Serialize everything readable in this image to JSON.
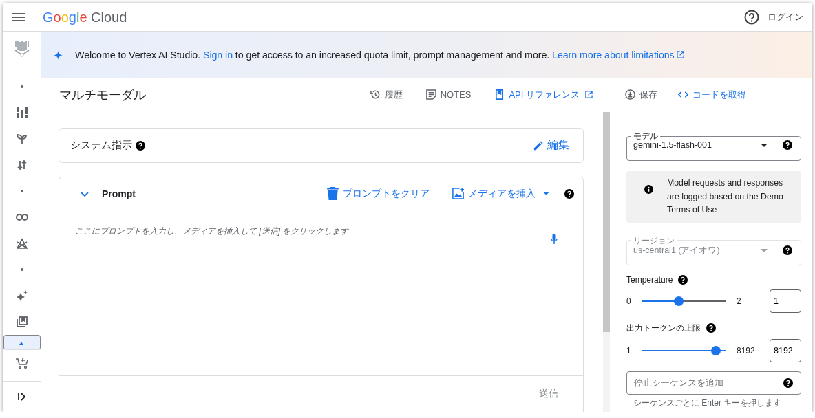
{
  "topbar": {
    "logo_google": "Google",
    "logo_cloud": "Cloud",
    "login": "ログイン"
  },
  "rail": {
    "items": [
      {
        "kind": "dot",
        "selected": false
      },
      {
        "kind": "grid",
        "selected": false
      },
      {
        "kind": "sprout",
        "selected": false
      },
      {
        "kind": "arrows",
        "selected": false
      },
      {
        "kind": "dot",
        "selected": false
      },
      {
        "kind": "link",
        "selected": false
      },
      {
        "kind": "tent",
        "selected": false
      },
      {
        "kind": "dot",
        "selected": false
      },
      {
        "kind": "sparkle",
        "selected": false
      },
      {
        "kind": "library",
        "selected": false
      },
      {
        "kind": "marker",
        "selected": true
      },
      {
        "kind": "cart",
        "selected": false
      }
    ]
  },
  "banner": {
    "lead": "Welcome to Vertex AI Studio.",
    "sign_in": "Sign in",
    "rest": "to get access to an increased quota limit, prompt management and more.",
    "learn_more": "Learn more about limitations"
  },
  "header": {
    "title": "マルチモーダル",
    "actions": [
      {
        "kind": "history",
        "label": "履歴"
      },
      {
        "kind": "notes",
        "label": "NOTES"
      },
      {
        "kind": "api",
        "label": "API リファレンス"
      }
    ],
    "side_actions": [
      {
        "kind": "save",
        "label": "保存"
      },
      {
        "kind": "code",
        "label": "コードを取得"
      }
    ]
  },
  "system": {
    "title": "システム指示",
    "edit": "編集"
  },
  "prompt": {
    "title": "Prompt",
    "expanded": true,
    "clear": "プロンプトをクリア",
    "insert": "メディアを挿入",
    "placeholder": "ここにプロンプトを入力し、メディアを挿入して [送信] をクリックします",
    "send": "送信",
    "send_disabled": true
  },
  "settings": {
    "model": {
      "label": "モデル",
      "value": "gemini-1.5-flash-001",
      "disabled": false
    },
    "notice": "Model requests and responses are logged based on the Demo Terms of Use",
    "region": {
      "label": "リージョン",
      "value": "us-central1 (アイオワ)",
      "disabled": true
    },
    "sliders": [
      {
        "label": "Temperature",
        "min": "0",
        "max": "2",
        "level": 0.5,
        "value": "1"
      },
      {
        "label": "出力トークンの上限",
        "min": "1",
        "max": "8192",
        "level": 1,
        "value": "8192"
      }
    ],
    "stop": {
      "placeholder": "停止シーケンスを追加",
      "hint": "シーケンスごとに Enter キーを押します"
    }
  }
}
